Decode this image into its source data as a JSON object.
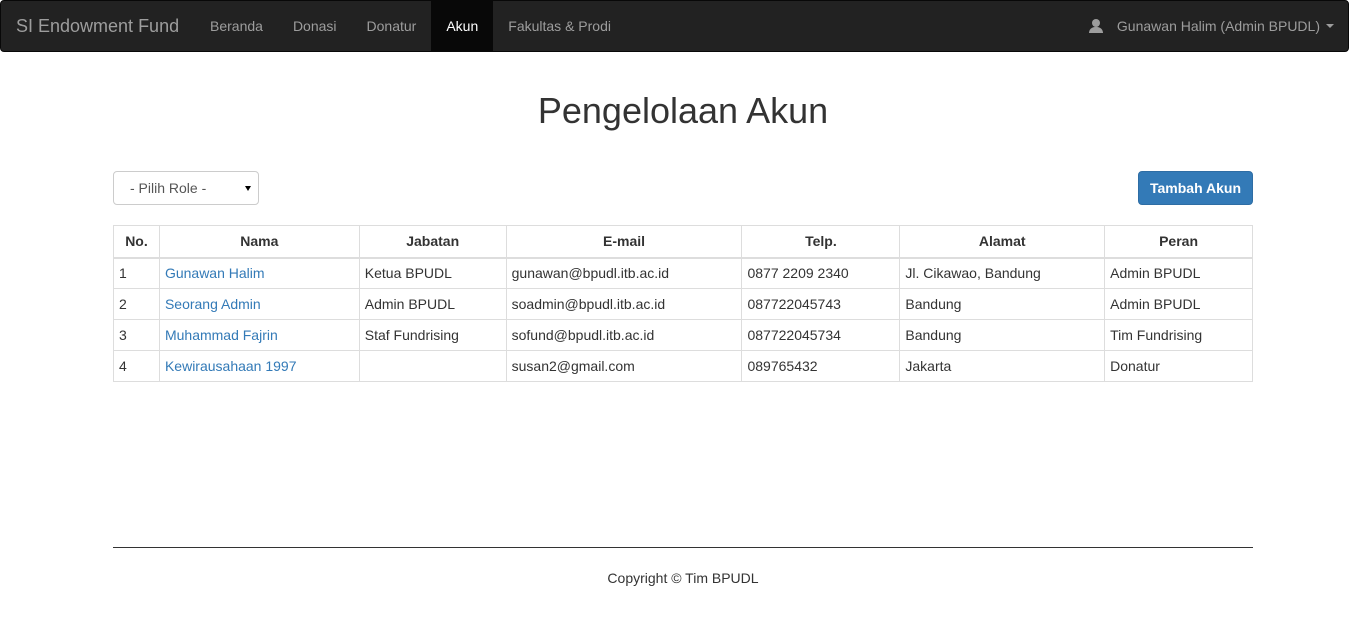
{
  "navbar": {
    "brand": "SI Endowment Fund",
    "items": [
      {
        "label": "Beranda"
      },
      {
        "label": "Donasi"
      },
      {
        "label": "Donatur"
      },
      {
        "label": "Akun"
      },
      {
        "label": "Fakultas & Prodi"
      }
    ],
    "active_item": "Akun",
    "user_label": "Gunawan Halim (Admin BPUDL)",
    "user_icon": "user-icon"
  },
  "page": {
    "title": "Pengelolaan Akun"
  },
  "toolbar": {
    "role_select_value": "- Pilih Role -",
    "add_button_label": "Tambah Akun"
  },
  "table": {
    "headers": [
      "No.",
      "Nama",
      "Jabatan",
      "E-mail",
      "Telp.",
      "Alamat",
      "Peran"
    ],
    "rows": [
      {
        "no": "1",
        "nama": "Gunawan Halim",
        "jabatan": "Ketua BPUDL",
        "email": "gunawan@bpudl.itb.ac.id",
        "telp": "0877 2209 2340",
        "alamat": "Jl. Cikawao, Bandung",
        "peran": "Admin BPUDL"
      },
      {
        "no": "2",
        "nama": "Seorang Admin",
        "jabatan": "Admin BPUDL",
        "email": "soadmin@bpudl.itb.ac.id",
        "telp": "087722045743",
        "alamat": "Bandung",
        "peran": "Admin BPUDL"
      },
      {
        "no": "3",
        "nama": "Muhammad Fajrin",
        "jabatan": "Staf Fundrising",
        "email": "sofund@bpudl.itb.ac.id",
        "telp": "087722045734",
        "alamat": "Bandung",
        "peran": "Tim Fundrising"
      },
      {
        "no": "4",
        "nama": "Kewirausahaan 1997",
        "jabatan": "",
        "email": "susan2@gmail.com",
        "telp": "089765432",
        "alamat": "Jakarta",
        "peran": "Donatur"
      }
    ]
  },
  "footer": {
    "text": "Copyright © Tim BPUDL"
  },
  "colors": {
    "navbar_bg": "#222222",
    "link": "#337ab7",
    "primary_button": "#337ab7"
  }
}
